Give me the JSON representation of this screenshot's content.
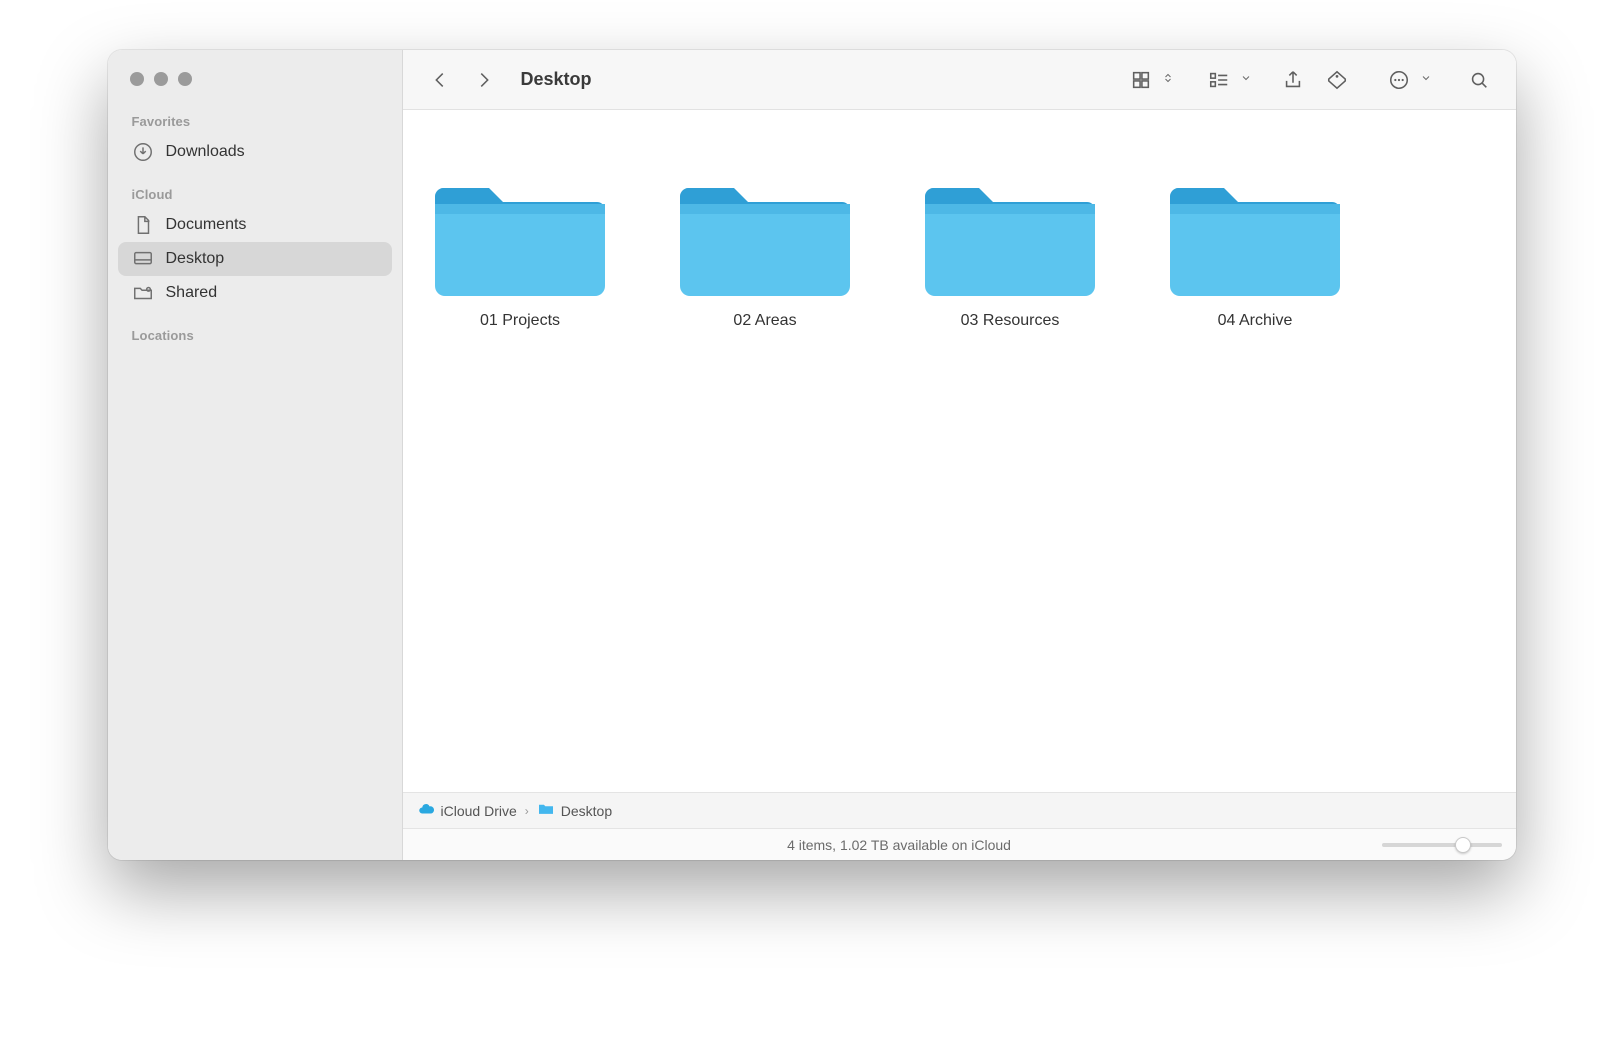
{
  "window": {
    "title": "Desktop"
  },
  "sidebar": {
    "sections": [
      {
        "heading": "Favorites",
        "items": [
          {
            "label": "Downloads",
            "icon": "download-circle-icon"
          }
        ]
      },
      {
        "heading": "iCloud",
        "items": [
          {
            "label": "Documents",
            "icon": "document-icon"
          },
          {
            "label": "Desktop",
            "icon": "desktop-icon",
            "selected": true
          },
          {
            "label": "Shared",
            "icon": "shared-folder-icon"
          }
        ]
      },
      {
        "heading": "Locations",
        "items": []
      }
    ]
  },
  "folders": [
    {
      "name": "01 Projects"
    },
    {
      "name": "02 Areas"
    },
    {
      "name": "03 Resources"
    },
    {
      "name": "04 Archive"
    }
  ],
  "pathbar": {
    "root": "iCloud Drive",
    "current": "Desktop"
  },
  "status": {
    "text": "4 items, 1.02 TB available on iCloud"
  }
}
